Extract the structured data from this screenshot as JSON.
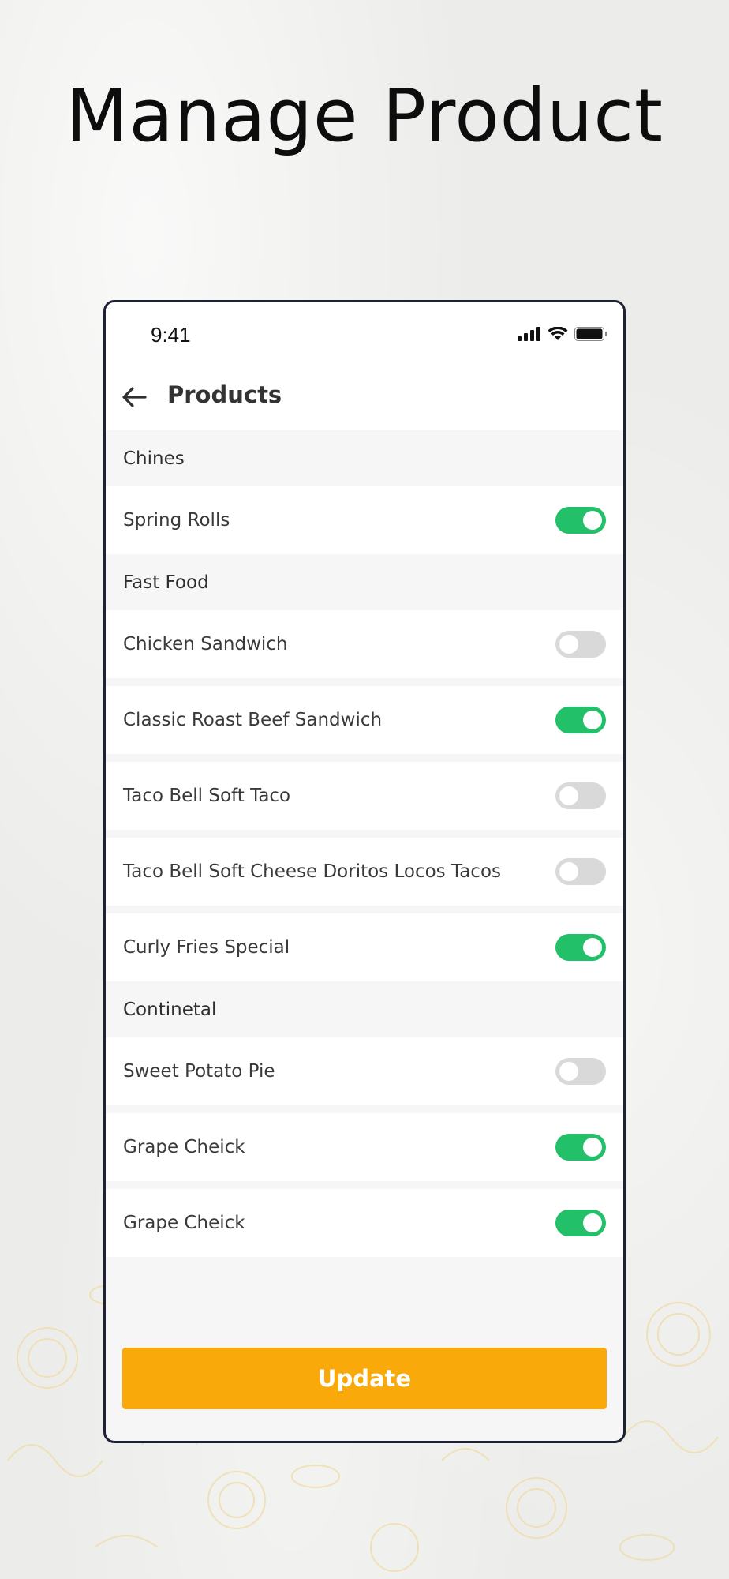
{
  "headline": "Manage Product",
  "status_bar": {
    "time": "9:41",
    "icons": [
      "cellular-signal-icon",
      "wifi-icon",
      "battery-icon"
    ]
  },
  "app_bar": {
    "back_icon": "arrow-left-icon",
    "title": "Products"
  },
  "categories": [
    {
      "name": "Chines",
      "items": [
        {
          "label": "Spring Rolls",
          "enabled": true
        }
      ]
    },
    {
      "name": "Fast Food",
      "items": [
        {
          "label": "Chicken Sandwich",
          "enabled": false
        },
        {
          "label": "Classic Roast Beef Sandwich",
          "enabled": true
        },
        {
          "label": "Taco Bell Soft Taco",
          "enabled": false
        },
        {
          "label": "Taco Bell Soft Cheese Doritos Locos Tacos",
          "enabled": false
        },
        {
          "label": "Curly Fries Special",
          "enabled": true
        }
      ]
    },
    {
      "name": "Continetal",
      "items": [
        {
          "label": "Sweet Potato Pie",
          "enabled": false
        },
        {
          "label": "Grape Cheick",
          "enabled": true
        },
        {
          "label": "Grape Cheick",
          "enabled": true
        }
      ]
    }
  ],
  "update_button": "Update",
  "colors": {
    "toggle_on": "#22c069",
    "toggle_off": "#d9d9d9",
    "accent_button": "#f9a90a",
    "phone_border": "#1d2235"
  }
}
